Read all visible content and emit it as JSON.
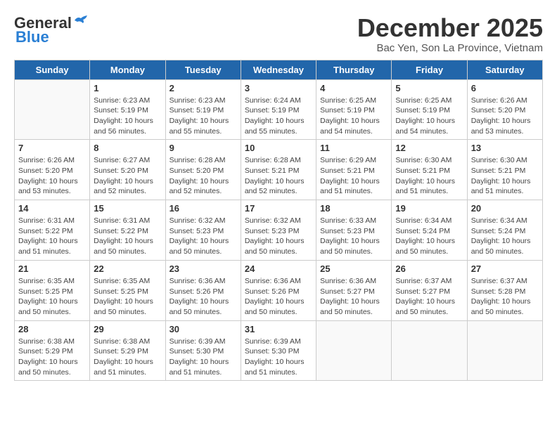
{
  "header": {
    "logo_general": "General",
    "logo_blue": "Blue",
    "title": "December 2025",
    "subtitle": "Bac Yen, Son La Province, Vietnam"
  },
  "weekdays": [
    "Sunday",
    "Monday",
    "Tuesday",
    "Wednesday",
    "Thursday",
    "Friday",
    "Saturday"
  ],
  "weeks": [
    [
      {
        "day": "",
        "info": ""
      },
      {
        "day": "1",
        "info": "Sunrise: 6:23 AM\nSunset: 5:19 PM\nDaylight: 10 hours\nand 56 minutes."
      },
      {
        "day": "2",
        "info": "Sunrise: 6:23 AM\nSunset: 5:19 PM\nDaylight: 10 hours\nand 55 minutes."
      },
      {
        "day": "3",
        "info": "Sunrise: 6:24 AM\nSunset: 5:19 PM\nDaylight: 10 hours\nand 55 minutes."
      },
      {
        "day": "4",
        "info": "Sunrise: 6:25 AM\nSunset: 5:19 PM\nDaylight: 10 hours\nand 54 minutes."
      },
      {
        "day": "5",
        "info": "Sunrise: 6:25 AM\nSunset: 5:19 PM\nDaylight: 10 hours\nand 54 minutes."
      },
      {
        "day": "6",
        "info": "Sunrise: 6:26 AM\nSunset: 5:20 PM\nDaylight: 10 hours\nand 53 minutes."
      }
    ],
    [
      {
        "day": "7",
        "info": "Sunrise: 6:26 AM\nSunset: 5:20 PM\nDaylight: 10 hours\nand 53 minutes."
      },
      {
        "day": "8",
        "info": "Sunrise: 6:27 AM\nSunset: 5:20 PM\nDaylight: 10 hours\nand 52 minutes."
      },
      {
        "day": "9",
        "info": "Sunrise: 6:28 AM\nSunset: 5:20 PM\nDaylight: 10 hours\nand 52 minutes."
      },
      {
        "day": "10",
        "info": "Sunrise: 6:28 AM\nSunset: 5:21 PM\nDaylight: 10 hours\nand 52 minutes."
      },
      {
        "day": "11",
        "info": "Sunrise: 6:29 AM\nSunset: 5:21 PM\nDaylight: 10 hours\nand 51 minutes."
      },
      {
        "day": "12",
        "info": "Sunrise: 6:30 AM\nSunset: 5:21 PM\nDaylight: 10 hours\nand 51 minutes."
      },
      {
        "day": "13",
        "info": "Sunrise: 6:30 AM\nSunset: 5:21 PM\nDaylight: 10 hours\nand 51 minutes."
      }
    ],
    [
      {
        "day": "14",
        "info": "Sunrise: 6:31 AM\nSunset: 5:22 PM\nDaylight: 10 hours\nand 51 minutes."
      },
      {
        "day": "15",
        "info": "Sunrise: 6:31 AM\nSunset: 5:22 PM\nDaylight: 10 hours\nand 50 minutes."
      },
      {
        "day": "16",
        "info": "Sunrise: 6:32 AM\nSunset: 5:23 PM\nDaylight: 10 hours\nand 50 minutes."
      },
      {
        "day": "17",
        "info": "Sunrise: 6:32 AM\nSunset: 5:23 PM\nDaylight: 10 hours\nand 50 minutes."
      },
      {
        "day": "18",
        "info": "Sunrise: 6:33 AM\nSunset: 5:23 PM\nDaylight: 10 hours\nand 50 minutes."
      },
      {
        "day": "19",
        "info": "Sunrise: 6:34 AM\nSunset: 5:24 PM\nDaylight: 10 hours\nand 50 minutes."
      },
      {
        "day": "20",
        "info": "Sunrise: 6:34 AM\nSunset: 5:24 PM\nDaylight: 10 hours\nand 50 minutes."
      }
    ],
    [
      {
        "day": "21",
        "info": "Sunrise: 6:35 AM\nSunset: 5:25 PM\nDaylight: 10 hours\nand 50 minutes."
      },
      {
        "day": "22",
        "info": "Sunrise: 6:35 AM\nSunset: 5:25 PM\nDaylight: 10 hours\nand 50 minutes."
      },
      {
        "day": "23",
        "info": "Sunrise: 6:36 AM\nSunset: 5:26 PM\nDaylight: 10 hours\nand 50 minutes."
      },
      {
        "day": "24",
        "info": "Sunrise: 6:36 AM\nSunset: 5:26 PM\nDaylight: 10 hours\nand 50 minutes."
      },
      {
        "day": "25",
        "info": "Sunrise: 6:36 AM\nSunset: 5:27 PM\nDaylight: 10 hours\nand 50 minutes."
      },
      {
        "day": "26",
        "info": "Sunrise: 6:37 AM\nSunset: 5:27 PM\nDaylight: 10 hours\nand 50 minutes."
      },
      {
        "day": "27",
        "info": "Sunrise: 6:37 AM\nSunset: 5:28 PM\nDaylight: 10 hours\nand 50 minutes."
      }
    ],
    [
      {
        "day": "28",
        "info": "Sunrise: 6:38 AM\nSunset: 5:29 PM\nDaylight: 10 hours\nand 50 minutes."
      },
      {
        "day": "29",
        "info": "Sunrise: 6:38 AM\nSunset: 5:29 PM\nDaylight: 10 hours\nand 51 minutes."
      },
      {
        "day": "30",
        "info": "Sunrise: 6:39 AM\nSunset: 5:30 PM\nDaylight: 10 hours\nand 51 minutes."
      },
      {
        "day": "31",
        "info": "Sunrise: 6:39 AM\nSunset: 5:30 PM\nDaylight: 10 hours\nand 51 minutes."
      },
      {
        "day": "",
        "info": ""
      },
      {
        "day": "",
        "info": ""
      },
      {
        "day": "",
        "info": ""
      }
    ]
  ]
}
